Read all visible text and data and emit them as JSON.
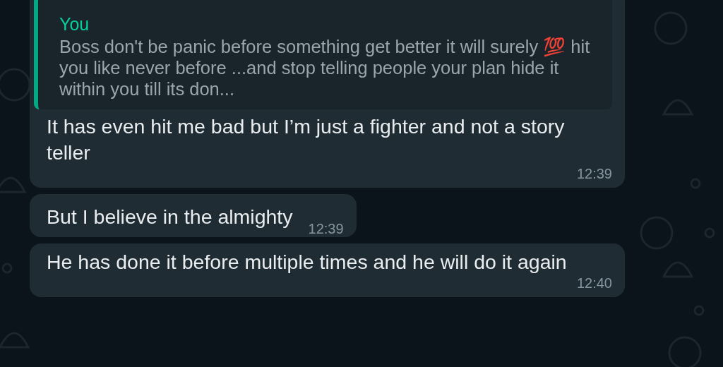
{
  "messages": [
    {
      "quote": {
        "author": "You",
        "text": "Boss don't be panic before something get better it will surely 💯 hit you like never before ...and stop telling people your plan hide it within you till its don..."
      },
      "text": "It has even hit me bad but I’m just a fighter and not a story teller",
      "time": "12:39"
    },
    {
      "text": "But I believe in the almighty",
      "time": "12:39"
    },
    {
      "text": "He has done it before multiple times and he will do it again",
      "time": "12:40"
    }
  ]
}
